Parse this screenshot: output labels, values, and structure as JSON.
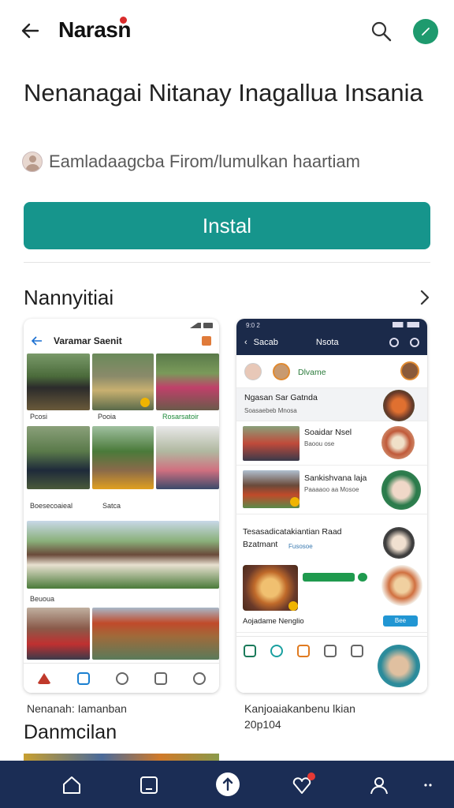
{
  "header": {
    "title": "Narasn",
    "icons": {
      "back": "arrow-left-icon",
      "search": "search-icon",
      "edit": "pencil-icon"
    },
    "accent": "#1e9a6e"
  },
  "app": {
    "name": "Nenanagai Nitanay Inagallua Insania",
    "developer": "Eamladaagcba Firom/lumulkan haartiam"
  },
  "install": {
    "label": "Instal",
    "color": "#16958c"
  },
  "screenshots_section": {
    "title": "Nannyitiai"
  },
  "shot1": {
    "header_title": "Varamar Saenit",
    "caps": [
      "Pcosi",
      "Pooia",
      "Rosarsatoir",
      "Boesecoaieal",
      "Satca",
      "Beuoua"
    ],
    "caption": "Nenanah: Iamanban"
  },
  "shot2": {
    "status_time": "9:0 2",
    "nav_left": "Sacab",
    "nav_center": "Nsota",
    "story_label": "Dlvame",
    "rows": [
      {
        "title": "Ngasan Sar Gatnda",
        "sub": "Soasaebeb   Mnosa"
      },
      {
        "title": "Soaidar Nsel",
        "sub": "Baoou ose"
      },
      {
        "title": "Sankishvana laja",
        "sub": "Paaaaoo aa Mosoe"
      },
      {
        "title": "Tesasadicatakiantian Raad",
        "title2": "Bzatmant",
        "sub": "Fusosoe"
      },
      {
        "title": "Aojadame Nenglio",
        "chip": "Bee"
      }
    ],
    "caption": "Kanjoaiakanbenu lkian 20p104"
  },
  "section2": {
    "title": "Danmcilan"
  },
  "bottom_nav": {
    "background": "#1b2d55",
    "icons": [
      "home-icon",
      "tablet-icon",
      "upload-icon",
      "heart-icon",
      "profile-icon",
      "more-icon"
    ]
  }
}
